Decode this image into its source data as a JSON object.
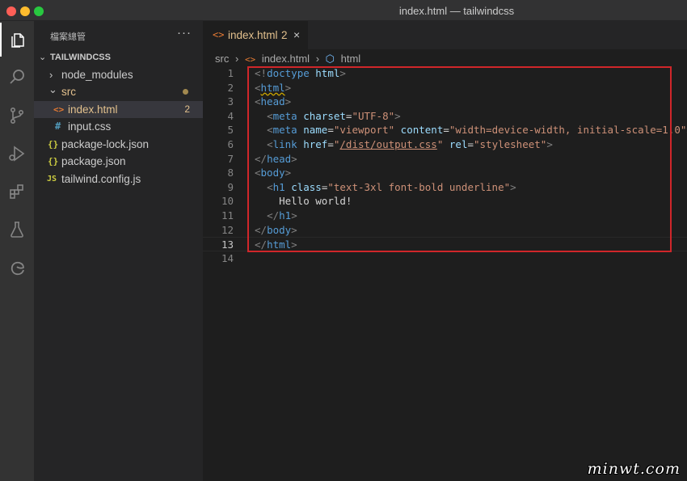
{
  "window": {
    "title": "index.html — tailwindcss"
  },
  "activity_bar": {
    "icons": [
      "explorer-icon",
      "search-icon",
      "source-control-icon",
      "run-debug-icon",
      "extensions-icon",
      "testing-icon",
      "edge-devtools-icon"
    ]
  },
  "sidebar": {
    "header": "檔案總管",
    "more": "···",
    "project": "TAILWINDCSS",
    "items": [
      {
        "label": "node_modules",
        "chevron": "›"
      },
      {
        "label": "src",
        "chevron": "⌄"
      },
      {
        "label": "index.html",
        "icon": "<>",
        "badge": "2"
      },
      {
        "label": "input.css",
        "icon": "#"
      },
      {
        "label": "package-lock.json",
        "icon": "{}"
      },
      {
        "label": "package.json",
        "icon": "{}"
      },
      {
        "label": "tailwind.config.js",
        "icon": "JS"
      }
    ]
  },
  "colors": {
    "accent": "#e2c08d",
    "highlight_box": "#d0262a",
    "html_icon": "#e37933",
    "css_icon": "#519aba",
    "json_icon": "#cbcb41"
  },
  "editor": {
    "tab": {
      "icon": "<>",
      "label": "index.html",
      "badge": "2",
      "close": "×"
    },
    "breadcrumb": [
      "src",
      "›",
      "<>",
      "index.html",
      "›",
      "html"
    ],
    "current_line": 13,
    "lines": [
      {
        "n": "1"
      },
      {
        "n": "2"
      },
      {
        "n": "3"
      },
      {
        "n": "4"
      },
      {
        "n": "5"
      },
      {
        "n": "6"
      },
      {
        "n": "7"
      },
      {
        "n": "8"
      },
      {
        "n": "9"
      },
      {
        "n": "10"
      },
      {
        "n": "11"
      },
      {
        "n": "12"
      },
      {
        "n": "13"
      },
      {
        "n": "14"
      }
    ],
    "code": {
      "doctype_kw": "doctype",
      "doctype_val": "html",
      "html_tag": "html",
      "head_tag": "head",
      "meta_tag": "meta",
      "charset_attr": "charset",
      "charset_val": "\"UTF-8\"",
      "name_attr": "name",
      "name_val": "\"viewport\"",
      "content_attr": "content",
      "content_val": "\"width=device-width, initial-scale=1.0\"",
      "link_tag": "link",
      "href_attr": "href",
      "href_q1": "\"",
      "href_path": "/dist/output.css",
      "href_q2": "\"",
      "rel_attr": "rel",
      "rel_val": "\"stylesheet\"",
      "body_tag": "body",
      "h1_tag": "h1",
      "class_attr": "class",
      "class_val": "\"text-3xl font-bold underline\"",
      "hello": "Hello world!"
    }
  },
  "watermark": "minwt.com"
}
